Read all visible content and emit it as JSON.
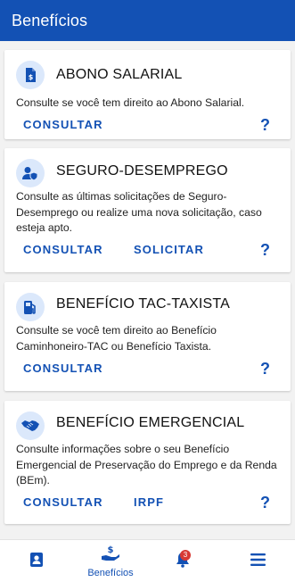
{
  "header": {
    "title": "Benefícios"
  },
  "cards": [
    {
      "icon": "money-document-icon",
      "title": "ABONO SALARIAL",
      "description": "Consulte se você tem direito ao Abono Salarial.",
      "actions": [
        "CONSULTAR"
      ],
      "help": "?"
    },
    {
      "icon": "person-shield-icon",
      "title": "SEGURO-DESEMPREGO",
      "description": "Consulte as últimas solicitações de Seguro-Desemprego ou realize uma nova solicitação, caso esteja apto.",
      "actions": [
        "CONSULTAR",
        "SOLICITAR"
      ],
      "help": "?"
    },
    {
      "icon": "fuel-pump-icon",
      "title": "BENEFÍCIO TAC-TAXISTA",
      "description": "Consulte se você tem direito ao Benefício Caminhoneiro-TAC ou Benefício Taxista.",
      "actions": [
        "CONSULTAR"
      ],
      "help": "?"
    },
    {
      "icon": "handshake-icon",
      "title": "BENEFÍCIO EMERGENCIAL",
      "description": "Consulte informações sobre o seu Benefício Emergencial de Preservação do Emprego e da Renda (BEm).",
      "actions": [
        "CONSULTAR",
        "IRPF"
      ],
      "help": "?"
    }
  ],
  "bottom_nav": {
    "items": [
      {
        "icon": "id-card-icon",
        "label": ""
      },
      {
        "icon": "hand-money-icon",
        "label": "Benefícios"
      },
      {
        "icon": "bell-icon",
        "label": "",
        "badge": "3"
      },
      {
        "icon": "menu-icon",
        "label": ""
      }
    ]
  },
  "colors": {
    "primary": "#1351b4",
    "icon_bg": "#dbe8fb",
    "badge": "#d83933"
  }
}
